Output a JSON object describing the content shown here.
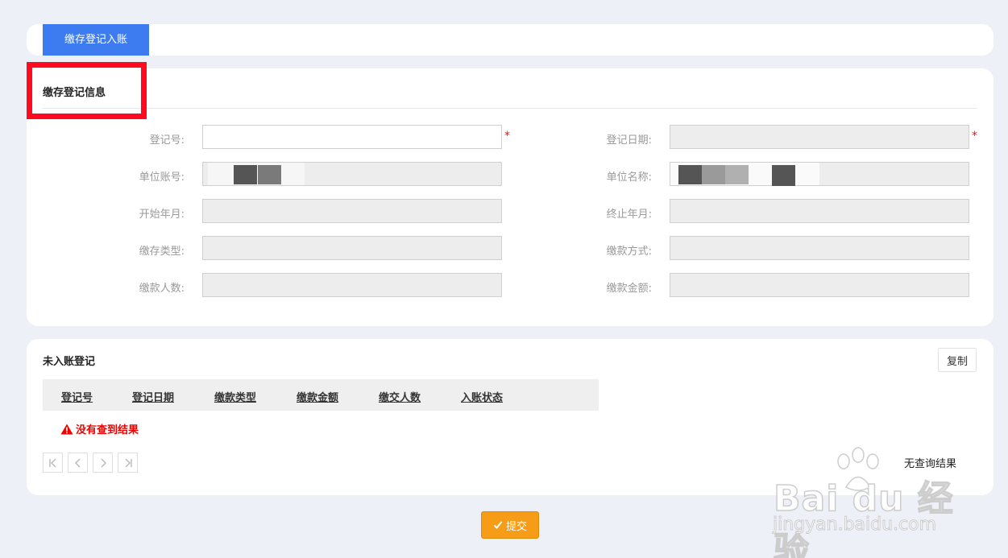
{
  "tabs": [
    {
      "label": "缴存登记入账",
      "active": true
    }
  ],
  "info_section": {
    "title": "缴存登记信息",
    "fields": [
      {
        "label": "登记号:",
        "value": "",
        "required": true,
        "editable": true
      },
      {
        "label": "登记日期:",
        "value": "",
        "required": true,
        "editable": false
      },
      {
        "label": "单位账号:",
        "value": "",
        "required": false,
        "editable": false,
        "redacted": true
      },
      {
        "label": "单位名称:",
        "value": "",
        "required": false,
        "editable": false,
        "redacted": true
      },
      {
        "label": "开始年月:",
        "value": "",
        "required": false,
        "editable": false
      },
      {
        "label": "终止年月:",
        "value": "",
        "required": false,
        "editable": false
      },
      {
        "label": "缴存类型:",
        "value": "",
        "required": false,
        "editable": false
      },
      {
        "label": "缴款方式:",
        "value": "",
        "required": false,
        "editable": false
      },
      {
        "label": "缴款人数:",
        "value": "",
        "required": false,
        "editable": false
      },
      {
        "label": "缴款金额:",
        "value": "",
        "required": false,
        "editable": false
      }
    ],
    "required_mark": "*"
  },
  "list_section": {
    "title": "未入账登记",
    "copy_label": "复制",
    "columns": [
      "登记号",
      "登记日期",
      "缴款类型",
      "缴款金额",
      "缴交人数",
      "入账状态"
    ],
    "rows": [],
    "empty_message": "没有查到结果",
    "status_text": "无查询结果"
  },
  "submit_label": "提交",
  "watermark": {
    "brand": "Bai du 经验",
    "url": "jingyan.baidu.com"
  },
  "colors": {
    "accent": "#3d7cf0",
    "submit": "#f69c17",
    "required": "#e11111",
    "highlight": "#ff0a1e",
    "error": "#e00000"
  }
}
